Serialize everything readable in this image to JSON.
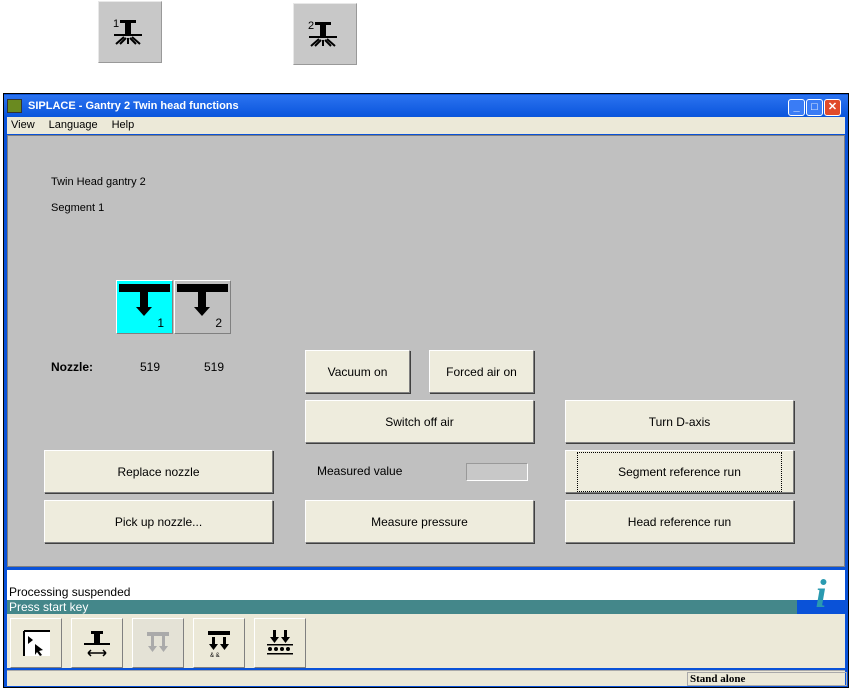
{
  "top_buttons": [
    {
      "icon": "head-1-icon",
      "label": "1"
    },
    {
      "icon": "head-2-icon",
      "label": "2"
    }
  ],
  "window": {
    "title": "SIPLACE - Gantry 2 Twin head functions"
  },
  "menu": [
    "View",
    "Language",
    "Help"
  ],
  "main": {
    "gantry": "Twin Head gantry 2",
    "segment": "Segment 1",
    "nozzle_label": "Nozzle:",
    "nozzles": [
      {
        "num": "1",
        "value": "519",
        "active": true
      },
      {
        "num": "2",
        "value": "519",
        "active": false
      }
    ],
    "measured_label": "Measured value",
    "measured_value": "",
    "buttons": {
      "vacuum": "Vacuum on",
      "forced_air": "Forced air on",
      "switch_off": "Switch off air",
      "turn_d": "Turn D-axis",
      "replace": "Replace nozzle",
      "segment_ref": "Segment reference run",
      "pickup": "Pick up nozzle...",
      "measure": "Measure pressure",
      "head_ref": "Head reference run"
    }
  },
  "messages": {
    "processing": "Processing suspended",
    "press": "Press start key"
  },
  "status": {
    "mode": "Stand alone"
  },
  "colors": {
    "active_nozzle": "#00ffff",
    "message_bar": "#44878a",
    "title_bar": "#0a55dc"
  }
}
